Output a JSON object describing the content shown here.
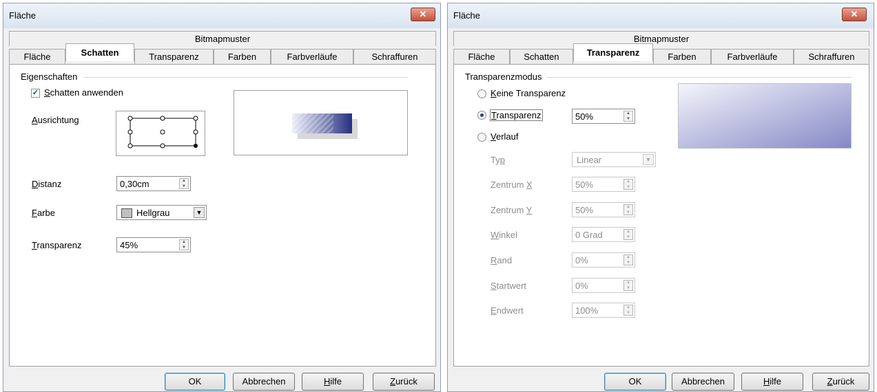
{
  "colors": {
    "gradient_dark": "#26307f",
    "gradient_light": "#eceef8",
    "shadow": "#d8d8d8",
    "close_button": "#c5503b",
    "disabled_text": "#8d8d8d"
  },
  "left": {
    "title": "Fläche",
    "close_icon": "close-icon",
    "bitmap_tab": "Bitmapmuster",
    "tabs": [
      "Fläche",
      "Schatten",
      "Transparenz",
      "Farben",
      "Farbverläufe",
      "Schraffuren"
    ],
    "active_tab": "Schatten",
    "group_title": "Eigenschaften",
    "apply_shadow": {
      "label": "Schatten anwenden",
      "checked": true,
      "check_mark": "✓"
    },
    "alignment_label": "Ausrichtung",
    "distance": {
      "label": "Distanz",
      "value": "0,30cm"
    },
    "color": {
      "label": "Farbe",
      "value": "Hellgrau",
      "swatch": "#c0c0c0"
    },
    "transparency": {
      "label": "Transparenz",
      "value": "45%"
    },
    "buttons": {
      "ok": "OK",
      "cancel": "Abbrechen",
      "help": "Hilfe",
      "back": "Zurück"
    }
  },
  "right": {
    "title": "Fläche",
    "close_icon": "close-icon",
    "bitmap_tab": "Bitmapmuster",
    "tabs": [
      "Fläche",
      "Schatten",
      "Transparenz",
      "Farben",
      "Farbverläufe",
      "Schraffuren"
    ],
    "active_tab": "Transparenz",
    "group_title": "Transparenzmodus",
    "mode_none": "Keine Transparenz",
    "mode_transparency": "Transparenz",
    "mode_transparency_value": "50%",
    "mode_gradient": "Verlauf",
    "selected_mode": "Transparenz",
    "type": {
      "label": "Typ",
      "value": "Linear"
    },
    "center_x": {
      "label": "Zentrum X",
      "value": "50%"
    },
    "center_y": {
      "label": "Zentrum Y",
      "value": "50%"
    },
    "angle": {
      "label": "Winkel",
      "value": "0 Grad"
    },
    "border": {
      "label": "Rand",
      "value": "0%"
    },
    "start_value": {
      "label": "Startwert",
      "value": "0%"
    },
    "end_value": {
      "label": "Endwert",
      "value": "100%"
    },
    "buttons": {
      "ok": "OK",
      "cancel": "Abbrechen",
      "help": "Hilfe",
      "back": "Zurück"
    }
  }
}
